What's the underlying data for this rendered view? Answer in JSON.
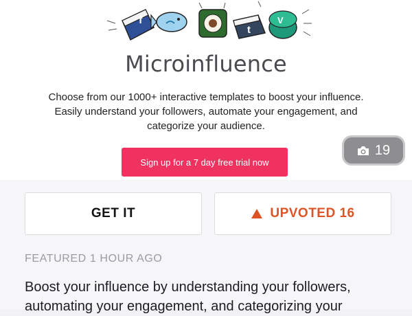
{
  "product": {
    "name": "Microinfluence",
    "description_lines": [
      "Choose from our 1000+ interactive templates to boost your influence.",
      "Easily understand your followers, automate your engagement, and",
      "categorize your audience."
    ],
    "cta_label": "Sign up for a 7 day free trial now"
  },
  "gallery": {
    "screenshot_count": "19",
    "icon": "camera-icon"
  },
  "actions": {
    "get_it_label": "GET IT",
    "upvoted_label": "UPVOTED 16",
    "upvote_icon": "triangle-up-icon"
  },
  "meta": {
    "featured_label": "FEATURED 1 HOUR AGO"
  },
  "blurb_lines": [
    "Boost your influence by understanding your followers,",
    "automating your engagement, and categorizing your"
  ],
  "colors": {
    "cta": "#ef3260",
    "upvote": "#dc5425",
    "badge": "#8e8e90"
  }
}
